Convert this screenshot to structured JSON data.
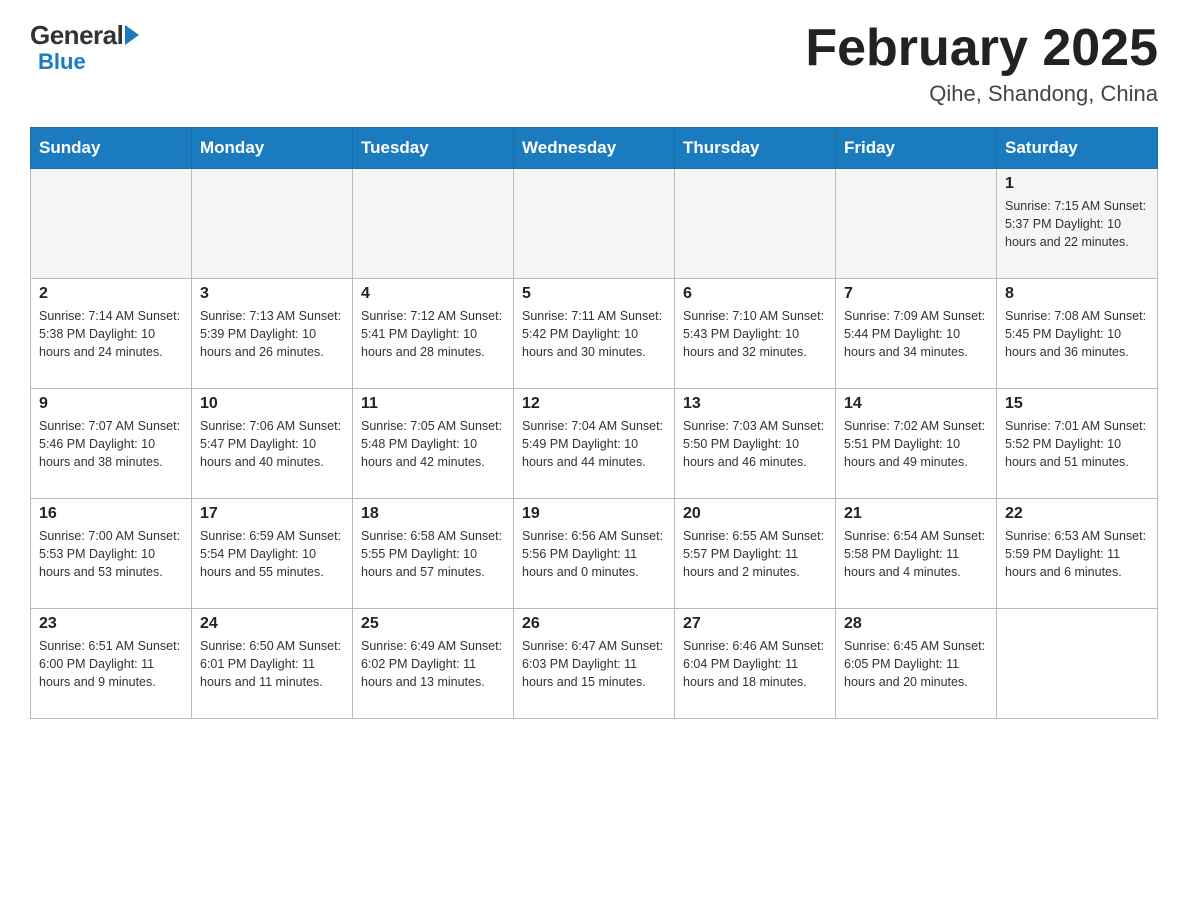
{
  "logo": {
    "general": "General",
    "blue": "Blue"
  },
  "header": {
    "month": "February 2025",
    "location": "Qihe, Shandong, China"
  },
  "days_of_week": [
    "Sunday",
    "Monday",
    "Tuesday",
    "Wednesday",
    "Thursday",
    "Friday",
    "Saturday"
  ],
  "weeks": [
    {
      "days": [
        {
          "num": "",
          "info": ""
        },
        {
          "num": "",
          "info": ""
        },
        {
          "num": "",
          "info": ""
        },
        {
          "num": "",
          "info": ""
        },
        {
          "num": "",
          "info": ""
        },
        {
          "num": "",
          "info": ""
        },
        {
          "num": "1",
          "info": "Sunrise: 7:15 AM\nSunset: 5:37 PM\nDaylight: 10 hours\nand 22 minutes."
        }
      ]
    },
    {
      "days": [
        {
          "num": "2",
          "info": "Sunrise: 7:14 AM\nSunset: 5:38 PM\nDaylight: 10 hours\nand 24 minutes."
        },
        {
          "num": "3",
          "info": "Sunrise: 7:13 AM\nSunset: 5:39 PM\nDaylight: 10 hours\nand 26 minutes."
        },
        {
          "num": "4",
          "info": "Sunrise: 7:12 AM\nSunset: 5:41 PM\nDaylight: 10 hours\nand 28 minutes."
        },
        {
          "num": "5",
          "info": "Sunrise: 7:11 AM\nSunset: 5:42 PM\nDaylight: 10 hours\nand 30 minutes."
        },
        {
          "num": "6",
          "info": "Sunrise: 7:10 AM\nSunset: 5:43 PM\nDaylight: 10 hours\nand 32 minutes."
        },
        {
          "num": "7",
          "info": "Sunrise: 7:09 AM\nSunset: 5:44 PM\nDaylight: 10 hours\nand 34 minutes."
        },
        {
          "num": "8",
          "info": "Sunrise: 7:08 AM\nSunset: 5:45 PM\nDaylight: 10 hours\nand 36 minutes."
        }
      ]
    },
    {
      "days": [
        {
          "num": "9",
          "info": "Sunrise: 7:07 AM\nSunset: 5:46 PM\nDaylight: 10 hours\nand 38 minutes."
        },
        {
          "num": "10",
          "info": "Sunrise: 7:06 AM\nSunset: 5:47 PM\nDaylight: 10 hours\nand 40 minutes."
        },
        {
          "num": "11",
          "info": "Sunrise: 7:05 AM\nSunset: 5:48 PM\nDaylight: 10 hours\nand 42 minutes."
        },
        {
          "num": "12",
          "info": "Sunrise: 7:04 AM\nSunset: 5:49 PM\nDaylight: 10 hours\nand 44 minutes."
        },
        {
          "num": "13",
          "info": "Sunrise: 7:03 AM\nSunset: 5:50 PM\nDaylight: 10 hours\nand 46 minutes."
        },
        {
          "num": "14",
          "info": "Sunrise: 7:02 AM\nSunset: 5:51 PM\nDaylight: 10 hours\nand 49 minutes."
        },
        {
          "num": "15",
          "info": "Sunrise: 7:01 AM\nSunset: 5:52 PM\nDaylight: 10 hours\nand 51 minutes."
        }
      ]
    },
    {
      "days": [
        {
          "num": "16",
          "info": "Sunrise: 7:00 AM\nSunset: 5:53 PM\nDaylight: 10 hours\nand 53 minutes."
        },
        {
          "num": "17",
          "info": "Sunrise: 6:59 AM\nSunset: 5:54 PM\nDaylight: 10 hours\nand 55 minutes."
        },
        {
          "num": "18",
          "info": "Sunrise: 6:58 AM\nSunset: 5:55 PM\nDaylight: 10 hours\nand 57 minutes."
        },
        {
          "num": "19",
          "info": "Sunrise: 6:56 AM\nSunset: 5:56 PM\nDaylight: 11 hours\nand 0 minutes."
        },
        {
          "num": "20",
          "info": "Sunrise: 6:55 AM\nSunset: 5:57 PM\nDaylight: 11 hours\nand 2 minutes."
        },
        {
          "num": "21",
          "info": "Sunrise: 6:54 AM\nSunset: 5:58 PM\nDaylight: 11 hours\nand 4 minutes."
        },
        {
          "num": "22",
          "info": "Sunrise: 6:53 AM\nSunset: 5:59 PM\nDaylight: 11 hours\nand 6 minutes."
        }
      ]
    },
    {
      "days": [
        {
          "num": "23",
          "info": "Sunrise: 6:51 AM\nSunset: 6:00 PM\nDaylight: 11 hours\nand 9 minutes."
        },
        {
          "num": "24",
          "info": "Sunrise: 6:50 AM\nSunset: 6:01 PM\nDaylight: 11 hours\nand 11 minutes."
        },
        {
          "num": "25",
          "info": "Sunrise: 6:49 AM\nSunset: 6:02 PM\nDaylight: 11 hours\nand 13 minutes."
        },
        {
          "num": "26",
          "info": "Sunrise: 6:47 AM\nSunset: 6:03 PM\nDaylight: 11 hours\nand 15 minutes."
        },
        {
          "num": "27",
          "info": "Sunrise: 6:46 AM\nSunset: 6:04 PM\nDaylight: 11 hours\nand 18 minutes."
        },
        {
          "num": "28",
          "info": "Sunrise: 6:45 AM\nSunset: 6:05 PM\nDaylight: 11 hours\nand 20 minutes."
        },
        {
          "num": "",
          "info": ""
        }
      ]
    }
  ]
}
